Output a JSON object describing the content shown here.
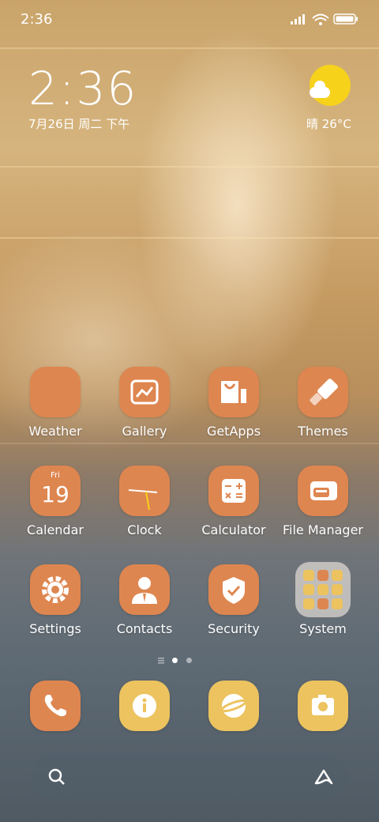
{
  "status_bar": {
    "time": "2:36"
  },
  "widget": {
    "clock": "2:36",
    "date": "7月26日 周二 下午",
    "weather": "晴 26°C"
  },
  "apps": [
    {
      "label": "Weather",
      "icon": "weather-icon"
    },
    {
      "label": "Gallery",
      "icon": "gallery-icon"
    },
    {
      "label": "GetApps",
      "icon": "shopping-bag-icon"
    },
    {
      "label": "Themes",
      "icon": "paint-brush-icon"
    },
    {
      "label": "Calendar",
      "icon": "calendar-icon",
      "day": "Fri",
      "date": "19"
    },
    {
      "label": "Clock",
      "icon": "clock-icon"
    },
    {
      "label": "Calculator",
      "icon": "calculator-icon"
    },
    {
      "label": "File Manager",
      "icon": "folder-icon"
    },
    {
      "label": "Settings",
      "icon": "gear-icon"
    },
    {
      "label": "Contacts",
      "icon": "person-icon"
    },
    {
      "label": "Security",
      "icon": "shield-icon"
    },
    {
      "label": "System",
      "icon": "folder-grid-icon"
    }
  ],
  "dock": [
    {
      "icon": "phone-icon"
    },
    {
      "icon": "info-icon"
    },
    {
      "icon": "browser-icon"
    },
    {
      "icon": "camera-icon"
    }
  ],
  "search": {
    "left_icon": "search-icon",
    "right_icon": "assistant-icon"
  },
  "colors": {
    "icon_orange": "#de8650",
    "icon_yellow": "#ecc35f",
    "sun": "#f7d21b"
  }
}
